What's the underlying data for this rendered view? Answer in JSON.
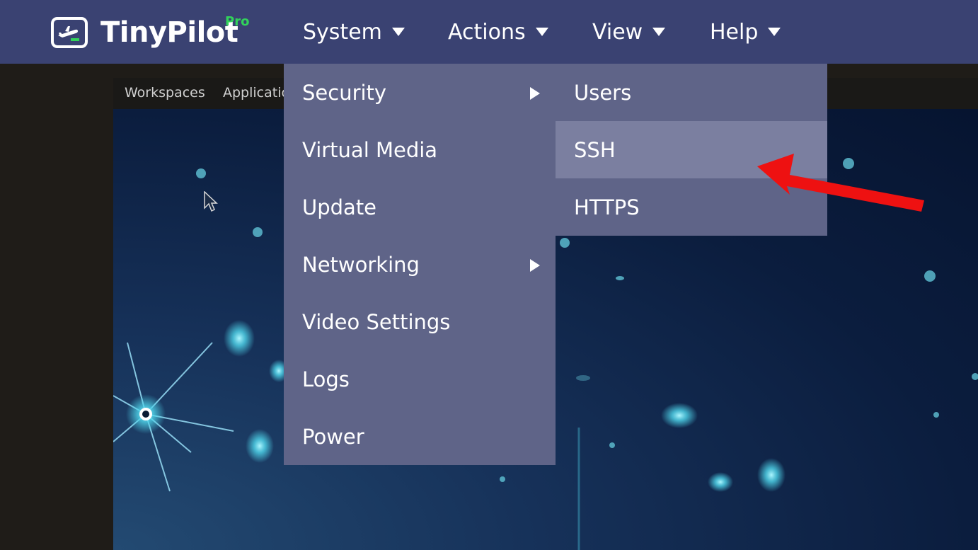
{
  "app": {
    "name": "TinyPilot",
    "badge": "Pro",
    "logo_icon": "airplane-terminal-icon"
  },
  "navbar": {
    "items": [
      {
        "label": "System"
      },
      {
        "label": "Actions"
      },
      {
        "label": "View"
      },
      {
        "label": "Help"
      }
    ]
  },
  "remote_desktop": {
    "taskbar": [
      "Workspaces",
      "Applicatio"
    ]
  },
  "system_menu": {
    "items": [
      {
        "label": "Security",
        "has_submenu": true
      },
      {
        "label": "Virtual Media",
        "has_submenu": false
      },
      {
        "label": "Update",
        "has_submenu": false
      },
      {
        "label": "Networking",
        "has_submenu": true
      },
      {
        "label": "Video Settings",
        "has_submenu": false
      },
      {
        "label": "Logs",
        "has_submenu": false
      },
      {
        "label": "Power",
        "has_submenu": false
      }
    ]
  },
  "security_submenu": {
    "items": [
      {
        "label": "Users",
        "highlighted": false
      },
      {
        "label": "SSH",
        "highlighted": true
      },
      {
        "label": "HTTPS",
        "highlighted": false
      }
    ]
  },
  "colors": {
    "navbar_bg": "#3a4272",
    "menu_bg": "#5f6488",
    "menu_highlight": "#7b7fa0",
    "pro_badge": "#31d35a",
    "annotation": "#ee1111"
  }
}
